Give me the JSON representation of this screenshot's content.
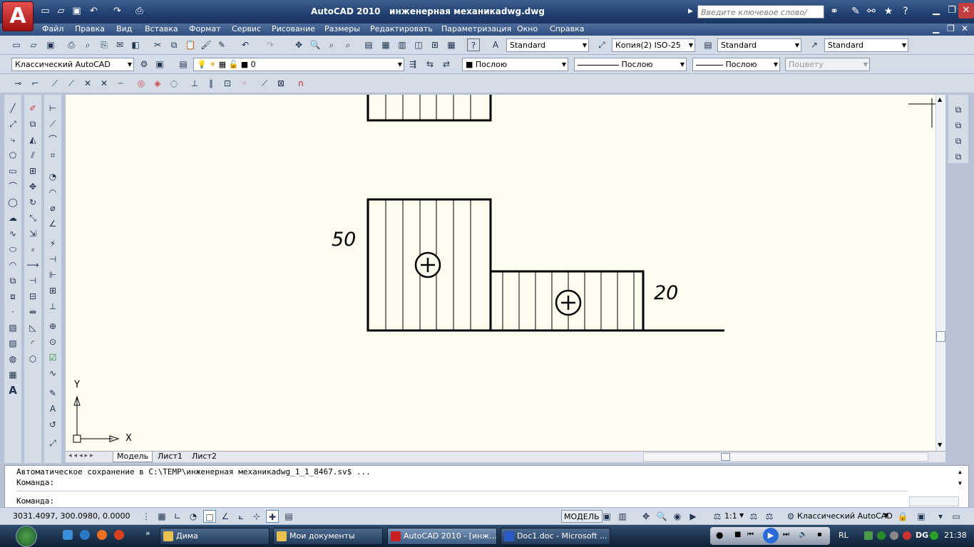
{
  "window": {
    "app_name": "AutoCAD 2010",
    "doc_name": "инженерная механикаdwg.dwg",
    "search_placeholder": "Введите ключевое слово/фразу"
  },
  "menu": [
    "Файл",
    "Правка",
    "Вид",
    "Вставка",
    "Формат",
    "Сервис",
    "Рисование",
    "Размеры",
    "Редактировать",
    "Параметризация",
    "Окно",
    "Справка"
  ],
  "styles": {
    "text_style": "Standard",
    "dim_style": "Копия(2) ISO-25",
    "table_style": "Standard",
    "multileader_style": "Standard"
  },
  "layers": {
    "workspace": "Классический AutoCAD",
    "current_layer": "0",
    "color": "Послою",
    "linetype": "Послою",
    "lineweight": "Послою",
    "plotstyle": "Поцвету"
  },
  "drawing": {
    "dim_left": "50",
    "dim_right": "20",
    "axis_x": "X",
    "axis_y": "Y"
  },
  "tabs": [
    "Модель",
    "Лист1",
    "Лист2"
  ],
  "command": {
    "line1": "Автоматическое сохранение в C:\\TEMP\\инженерная механикаdwg_1_1_8467.sv$ ...",
    "line2": "Команда:",
    "prompt": "Команда:"
  },
  "status": {
    "coords": "3031.4097, 300.0980, 0.0000",
    "model": "МОДЕЛЬ",
    "scale": "1:1",
    "workspace": "Классический AutoCAD"
  },
  "taskbar": {
    "items": [
      "Дима",
      "Мои документы",
      "AutoCAD 2010 - [инж...",
      "Doc1.doc - Microsoft ..."
    ],
    "lang": "RL",
    "clock": "21:38"
  },
  "colors": {
    "canvas_bg": "#fdfcef",
    "ribbon_blue": "#1f3f70",
    "toolbar_bg": "#d4dce8"
  }
}
